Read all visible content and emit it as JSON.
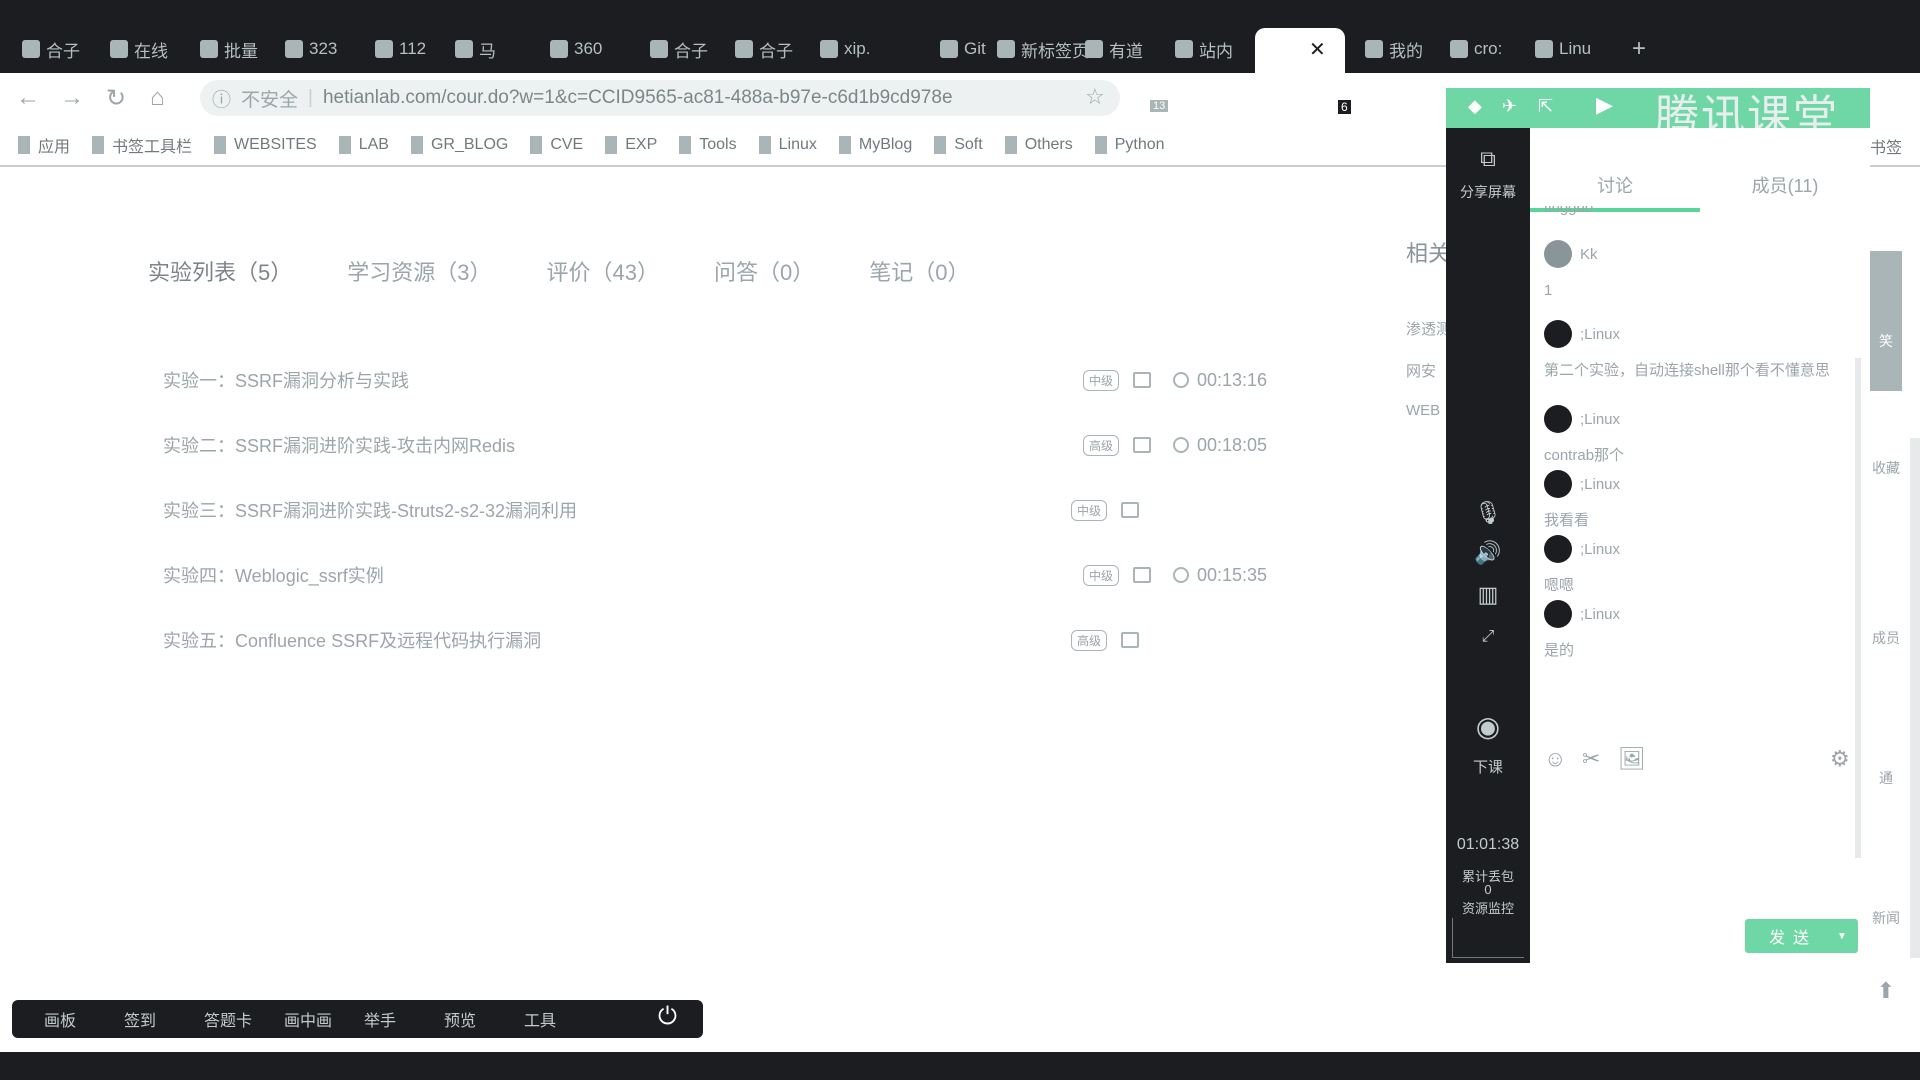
{
  "browser": {
    "tabs": [
      "合子",
      "在线",
      "批量",
      "323",
      "112",
      "马",
      "360",
      "合子",
      "合子",
      "xip.",
      "Git",
      "新标签页",
      "有道",
      "站内",
      "",
      "我的",
      "cro:",
      "Linu"
    ],
    "new_tab": "+",
    "close": "✕",
    "security": "不安全",
    "url": "hetianlab.com/cour.do?w=1&c=CCID9565-ac81-488a-b97e-c6d1b9cd978e",
    "badges": [
      "13",
      "6"
    ],
    "bookmarks": [
      "应用",
      "书签工具栏",
      "WEBSITES",
      "LAB",
      "GR_BLOG",
      "CVE",
      "EXP",
      "Tools",
      "Linux",
      "MyBlog",
      "Soft",
      "Others",
      "Python"
    ],
    "bookmarks_more": "书签"
  },
  "content": {
    "tabs": [
      "实验列表（5）",
      "学习资源（3）",
      "评价（43）",
      "问答（0）",
      "笔记（0）"
    ],
    "experiments": [
      {
        "title": "实验一：SSRF漏洞分析与实践",
        "level": "中级",
        "duration": "00:13:16"
      },
      {
        "title": "实验二：SSRF漏洞进阶实践-攻击内网Redis",
        "level": "高级",
        "duration": "00:18:05"
      },
      {
        "title": "实验三：SSRF漏洞进阶实践-Struts2-s2-32漏洞利用",
        "level": "中级",
        "duration": ""
      },
      {
        "title": "实验四：Weblogic_ssrf实例",
        "level": "中级",
        "duration": "00:15:35"
      },
      {
        "title": "实验五：Confluence SSRF及远程代码执行漏洞",
        "level": "高级",
        "duration": ""
      }
    ],
    "related_title": "相关",
    "related": [
      "渗透测",
      "网安",
      "WEB"
    ]
  },
  "classroom": {
    "logo": "腾讯课堂",
    "share_screen": "分享屏幕",
    "end_class": "下课",
    "timer": "01:01:38",
    "packet_loss_label": "累计丢包",
    "packet_loss": "0",
    "monitor": "资源监控",
    "chat_tabs": [
      "讨论",
      "成员(11)"
    ],
    "partial_name": "tingguo",
    "messages": [
      {
        "user": "Kk",
        "text": "1"
      },
      {
        "user": ";Linux",
        "text": "第二个实验，自动连接shell那个看不懂意思"
      },
      {
        "user": ";Linux",
        "text": "contrab那个"
      },
      {
        "user": ";Linux",
        "text": "我看看"
      },
      {
        "user": ";Linux",
        "text": "嗯嗯"
      },
      {
        "user": ";Linux",
        "text": "是的"
      }
    ],
    "send": "发送",
    "right_strip": [
      "笑",
      "收藏",
      "成员",
      "通",
      "新闻"
    ],
    "toolbar": [
      "画板",
      "签到",
      "答题卡",
      "画中画",
      "举手",
      "预览",
      "工具"
    ],
    "accent": "#5ad59a"
  }
}
